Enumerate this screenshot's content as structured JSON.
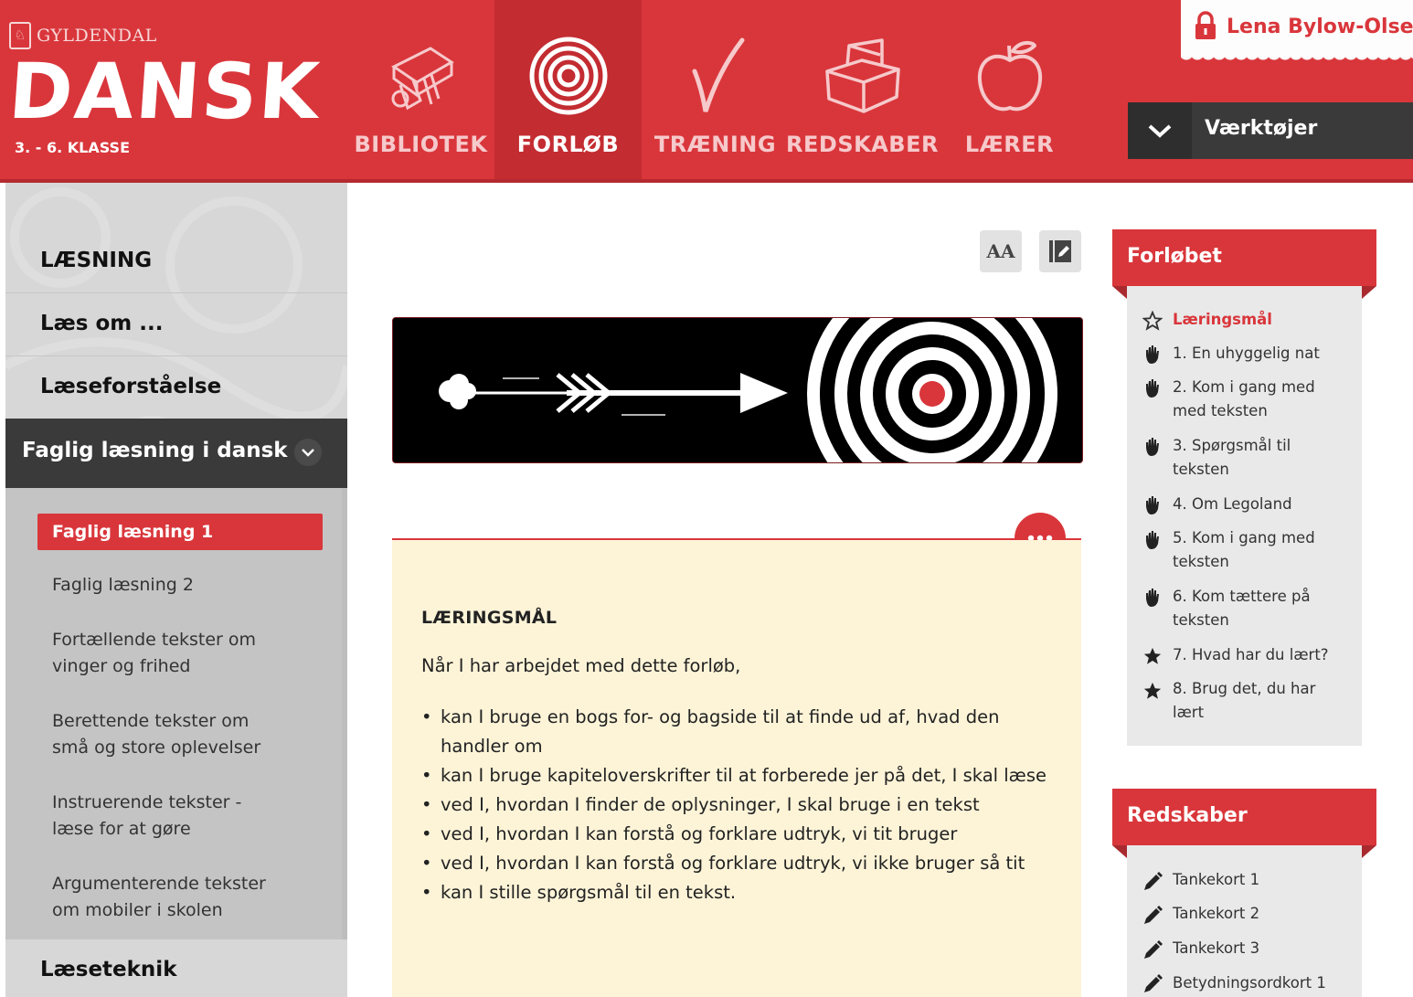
{
  "header": {
    "publisher": "GYLDENDAL",
    "logo": "DANSK",
    "grade": "3. - 6. KLASSE",
    "nav": [
      {
        "label": "BIBLIOTEK",
        "icon": "books-icon",
        "active": false
      },
      {
        "label": "FORLØB",
        "icon": "spiral-icon",
        "active": true
      },
      {
        "label": "TRÆNING",
        "icon": "checkmark-icon",
        "active": false
      },
      {
        "label": "REDSKABER",
        "icon": "toolbox-icon",
        "active": false
      },
      {
        "label": "LÆRER",
        "icon": "apple-icon",
        "active": false
      }
    ],
    "user_name": "Lena Bylow-Olse",
    "tools_label": "Værktøjer"
  },
  "sidebar": {
    "top_items": [
      "LÆSNING",
      "Læs om ...",
      "Læseforståelse"
    ],
    "active_item": "Faglig læsning i dansk",
    "sub_items": [
      "Faglig læsning 1",
      "Faglig læsning 2",
      "Fortællende tekster om vinger og frihed",
      "Berettende tekster om små og store oplevelser",
      "Instruerende tekster - læse for at gøre",
      "Argumenterende tekster om mobiler i skolen"
    ],
    "bottom_item": "Læseteknik"
  },
  "main": {
    "font_size_btn": "AA",
    "goals": {
      "heading": "LÆRINGSMÅL",
      "intro": "Når I har arbejdet med dette forløb,",
      "bullets": [
        "kan I bruge en bogs for- og bagside til at finde ud af, hvad den handler om",
        "kan I bruge kapiteloverskrifter til at forberede jer på det, I skal læse",
        "ved I, hvordan I finder de oplysninger, I skal bruge i en tekst",
        "ved I, hvordan I kan forstå og forklare udtryk, vi tit bruger",
        "ved I, hvordan I kan forstå og forklare udtryk, vi ikke bruger så tit",
        "kan I stille spørgsmål til en tekst."
      ]
    }
  },
  "forloebet": {
    "title": "Forløbet",
    "items": [
      {
        "label": "Læringsmål",
        "icon": "star-outline-icon",
        "current": true
      },
      {
        "label": "1. En uhyggelig nat",
        "icon": "hand-icon"
      },
      {
        "label": "2. Kom i gang med med teksten",
        "icon": "hand-icon"
      },
      {
        "label": "3. Spørgsmål til teksten",
        "icon": "hand-icon"
      },
      {
        "label": "4. Om Legoland",
        "icon": "hand-icon"
      },
      {
        "label": "5. Kom i gang med teksten",
        "icon": "hand-icon"
      },
      {
        "label": "6. Kom tættere på teksten",
        "icon": "hand-icon"
      },
      {
        "label": "7. Hvad har du lært?",
        "icon": "star-icon"
      },
      {
        "label": "8. Brug det, du har lært",
        "icon": "star-icon"
      }
    ]
  },
  "redskaber": {
    "title": "Redskaber",
    "items": [
      "Tankekort 1",
      "Tankekort 2",
      "Tankekort 3",
      "Betydningsordkort 1"
    ]
  },
  "colors": {
    "brand_red": "#d9363b",
    "dark": "#3a3a3a",
    "goals_bg": "#fdf4d8"
  }
}
